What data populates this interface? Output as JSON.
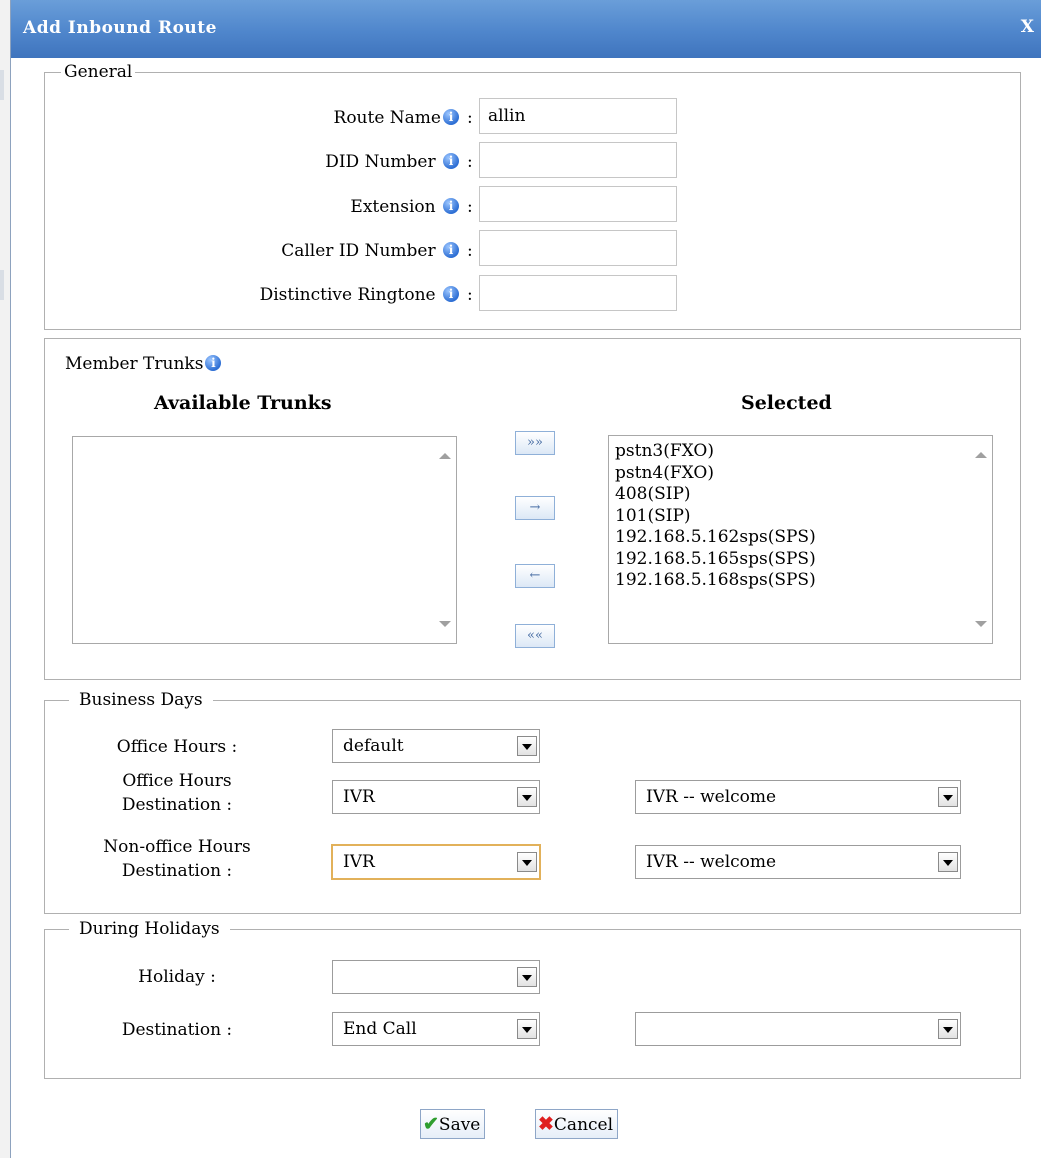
{
  "dialog": {
    "title": "Add Inbound Route",
    "close": "X"
  },
  "general": {
    "legend": "General",
    "fields": {
      "route_name": {
        "label": "Route Name",
        "value": "allin"
      },
      "did_number": {
        "label": "DID Number",
        "value": ""
      },
      "extension": {
        "label": "Extension",
        "value": ""
      },
      "caller_id": {
        "label": "Caller ID Number",
        "value": ""
      },
      "ringtone": {
        "label": "Distinctive Ringtone",
        "value": ""
      }
    },
    "colon": ":"
  },
  "trunks": {
    "label": "Member Trunks",
    "available_title": "Available Trunks",
    "selected_title": "Selected",
    "available": [],
    "selected": [
      "pstn3(FXO)",
      "pstn4(FXO)",
      "408(SIP)",
      "101(SIP)",
      "192.168.5.162sps(SPS)",
      "192.168.5.165sps(SPS)",
      "192.168.5.168sps(SPS)"
    ],
    "buttons": {
      "add_all": "»»",
      "add": "→",
      "remove": "←",
      "remove_all": "««"
    }
  },
  "business": {
    "legend": "Business Days",
    "office_hours_label": "Office Hours :",
    "office_hours_value": "default",
    "office_dest_label_1": "Office Hours",
    "office_dest_label_2": "Destination :",
    "office_dest_type": "IVR",
    "office_dest_value": "IVR -- welcome",
    "nonoffice_label_1": "Non-office Hours",
    "nonoffice_label_2": "Destination :",
    "nonoffice_type": "IVR",
    "nonoffice_value": "IVR -- welcome"
  },
  "holidays": {
    "legend": "During Holidays",
    "holiday_label": "Holiday :",
    "holiday_value": "",
    "dest_label": "Destination :",
    "dest_type": "End Call",
    "dest_value": ""
  },
  "actions": {
    "save": "Save",
    "cancel": "Cancel"
  },
  "colors": {
    "titlebar": "#4f86cc",
    "info_icon": "#2e6fd4",
    "focus_border": "#e2b15a"
  }
}
